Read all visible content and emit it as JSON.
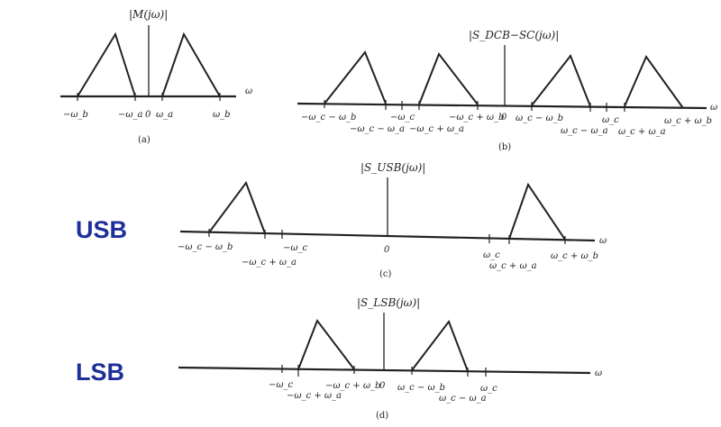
{
  "side_labels": {
    "usb": "USB",
    "lsb": "LSB"
  },
  "panel_a": {
    "title": "|M(jω)|",
    "caption": "(a)",
    "axis_var": "ω",
    "ticks": [
      "−ω_b",
      "−ω_a",
      "0",
      "ω_a",
      "ω_b"
    ]
  },
  "panel_b": {
    "title": "|S_DCB−SC(jω)|",
    "caption": "(b)",
    "axis_var": "ω",
    "ticks": [
      "−ω_c − ω_b",
      "−ω_c − ω_a",
      "−ω_c",
      "−ω_c + ω_a",
      "−ω_c + ω_b",
      "0",
      "ω_c − ω_b",
      "ω_c − ω_a",
      "ω_c",
      "ω_c + ω_a",
      "ω_c + ω_b"
    ]
  },
  "panel_c": {
    "title": "|S_USB(jω)|",
    "caption": "(c)",
    "axis_var": "ω",
    "ticks": [
      "−ω_c − ω_b",
      "−ω_c + ω_a",
      "−ω_c",
      "0",
      "ω_c",
      "ω_c + ω_a",
      "ω_c + ω_b"
    ]
  },
  "panel_d": {
    "title": "|S_LSB(jω)|",
    "caption": "(d)",
    "axis_var": "ω",
    "ticks": [
      "−ω_c",
      "−ω_c + ω_a",
      "−ω_c + ω_b",
      "0",
      "ω_c − ω_b",
      "ω_c − ω_a",
      "ω_c"
    ]
  }
}
